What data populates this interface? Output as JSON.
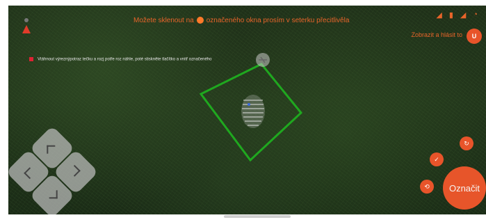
{
  "top_message": {
    "part1": "Možete sklenout na",
    "part2": "označeného okna prosím v seterku přecitlivěla"
  },
  "report": {
    "link_label": "Zobrazit a hlásit to",
    "badge_label": "U"
  },
  "hint_text": "Vtáhnout výreznýpotraz tečku a rozj potře roz náhle, poté stiskněte tlačítko a vnitř označeného",
  "dpad": {
    "up": "chevron-up",
    "down": "chevron-down",
    "left": "chevron-left",
    "right": "chevron-right"
  },
  "actions": {
    "mark_label": "Označit",
    "small_icons": [
      "rotate-icon",
      "check-icon",
      "refresh-icon"
    ]
  },
  "colors": {
    "accent": "#e8542a",
    "frame": "#1fa81f",
    "background": "#1f3019"
  }
}
